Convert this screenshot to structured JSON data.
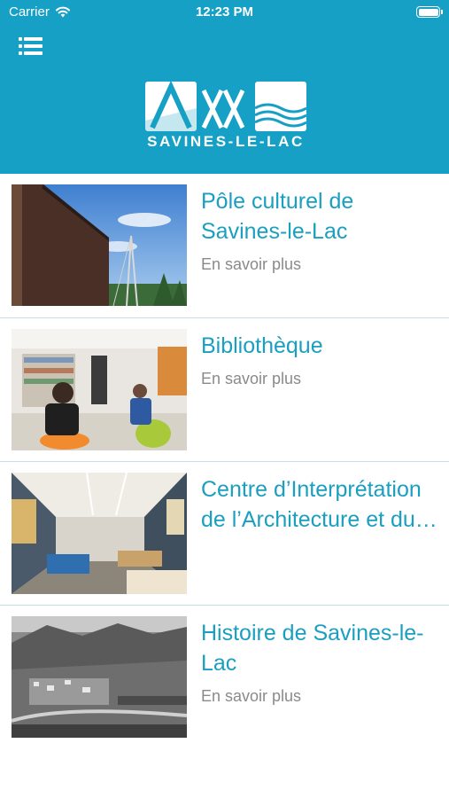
{
  "status_bar": {
    "carrier": "Carrier",
    "time": "12:23 PM",
    "wifi_icon": "wifi-icon",
    "battery_icon": "battery-icon"
  },
  "header": {
    "menu_icon": "list-menu-icon",
    "background_color": "#16a0c5",
    "logo": {
      "caption": "SAVINES-LE-LAC"
    }
  },
  "items": [
    {
      "title": "Pôle culturel de Savines-le-Lac",
      "more": "En savoir plus",
      "image": "modern building photo"
    },
    {
      "title": "Bibliothèque",
      "more": "En savoir plus",
      "image": "library interior photo"
    },
    {
      "title": "Centre d’Interprétation de l’Architecture et du…",
      "more": "",
      "image": "exhibition hall photo"
    },
    {
      "title": "Histoire de Savines-le-Lac",
      "more": "En savoir plus",
      "image": "black and white village photo"
    }
  ],
  "colors": {
    "accent": "#1a9fc0",
    "secondary_text": "#8a8a8a",
    "divider": "#bfe0ea"
  }
}
